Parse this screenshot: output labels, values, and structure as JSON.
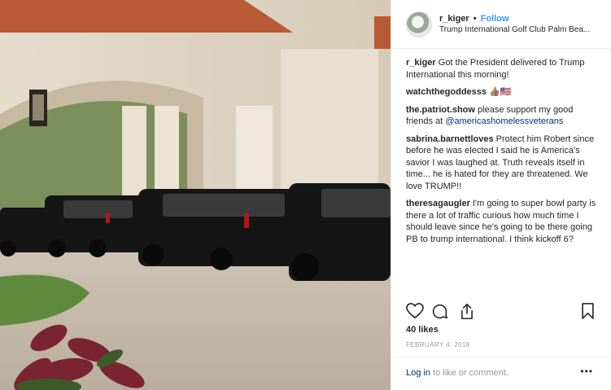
{
  "header": {
    "username": "r_kiger",
    "separator": "•",
    "follow_label": "Follow",
    "location": "Trump International Golf Club Palm Bea..."
  },
  "comments": [
    {
      "user": "r_kiger",
      "text": "Got the President delivered to Trump International this morning!",
      "tag": ""
    },
    {
      "user": "watchthegoddesss",
      "text": "👍🏽🇺🇸",
      "tag": ""
    },
    {
      "user": "the.patriot.show",
      "text": "please support my good friends at",
      "tag": "@americashomelessveterans"
    },
    {
      "user": "sabrina.barnettloves",
      "text": "Protect him Robert since before he was elected I said he is America's savior I was laughed at. Truth reveals itself in time... he is hated for they are threatened. We love TRUMP!!",
      "tag": ""
    },
    {
      "user": "theresagaugler",
      "text": "I'm going to super bowl party is there a lot of traffic curious how much time I should leave since he's going to be there going PB to trump international. I think kickoff 6?",
      "tag": ""
    }
  ],
  "actions": {
    "icons": [
      "heart-icon",
      "comment-icon",
      "share-icon",
      "bookmark-icon"
    ]
  },
  "likes": "40 likes",
  "date": "FEBRUARY 4, 2018",
  "login": {
    "link": "Log in",
    "text": " to like or comment."
  },
  "more_label": "•••",
  "colors": {
    "link_blue": "#3897f0",
    "tag_blue": "#003569",
    "muted": "#999999",
    "text": "#262626"
  }
}
